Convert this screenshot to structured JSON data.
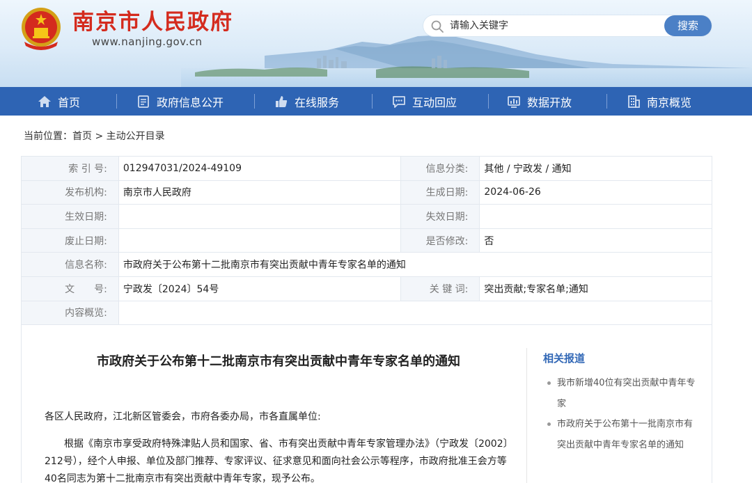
{
  "site": {
    "title": "南京市人民政府",
    "domain": "www.nanjing.gov.cn"
  },
  "search": {
    "placeholder": "请输入关键字",
    "button_label": "搜索"
  },
  "nav": {
    "items": [
      {
        "label": "首页",
        "icon": "home-icon"
      },
      {
        "label": "政府信息公开",
        "icon": "document-icon"
      },
      {
        "label": "在线服务",
        "icon": "thumbs-up-icon"
      },
      {
        "label": "互动回应",
        "icon": "chat-icon"
      },
      {
        "label": "数据开放",
        "icon": "chart-icon"
      },
      {
        "label": "南京概览",
        "icon": "building-icon"
      }
    ]
  },
  "breadcrumb": {
    "prefix": "当前位置：",
    "home": "首页",
    "separator": " > ",
    "current": "主动公开目录"
  },
  "meta": {
    "index_label": "索 引 号:",
    "index_value": "012947031/2024-49109",
    "category_label": "信息分类:",
    "category_value": "其他 / 宁政发 / 通知",
    "publisher_label": "发布机构:",
    "publisher_value": "南京市人民政府",
    "created_label": "生成日期:",
    "created_value": "2024-06-26",
    "effective_label": "生效日期:",
    "effective_value": "",
    "expiry_label": "失效日期:",
    "expiry_value": "",
    "abolished_label": "废止日期:",
    "abolished_value": "",
    "modified_label": "是否修改:",
    "modified_value": "否",
    "name_label": "信息名称:",
    "name_value": "市政府关于公布第十二批南京市有突出贡献中青年专家名单的通知",
    "docno_label": "文　　号:",
    "docno_value": "宁政发〔2024〕54号",
    "keywords_label": "关 键 词:",
    "keywords_value": "突出贡献;专家名单;通知",
    "summary_label": "内容概览:",
    "summary_value": ""
  },
  "document": {
    "title": "市政府关于公布第十二批南京市有突出贡献中青年专家名单的通知",
    "salutation": "各区人民政府，江北新区管委会，市府各委办局，市各直属单位:",
    "paragraph1": "根据《南京市享受政府特殊津贴人员和国家、省、市有突出贡献中青年专家管理办法》（宁政发〔2002〕212号），经个人申报、单位及部门推荐、专家评议、征求意见和面向社会公示等程序，市政府批准王会方等40名同志为第十二批南京市有突出贡献中青年专家，现予公布。"
  },
  "related": {
    "title": "相关报道",
    "items": [
      "我市新增40位有突出贡献中青年专家",
      "市政府关于公布第十一批南京市有突出贡献中青年专家名单的通知"
    ]
  },
  "colors": {
    "brand_red": "#d42b1e",
    "nav_blue": "#2e64b4",
    "search_button": "#4b80c6",
    "related_title": "#3268b6"
  }
}
